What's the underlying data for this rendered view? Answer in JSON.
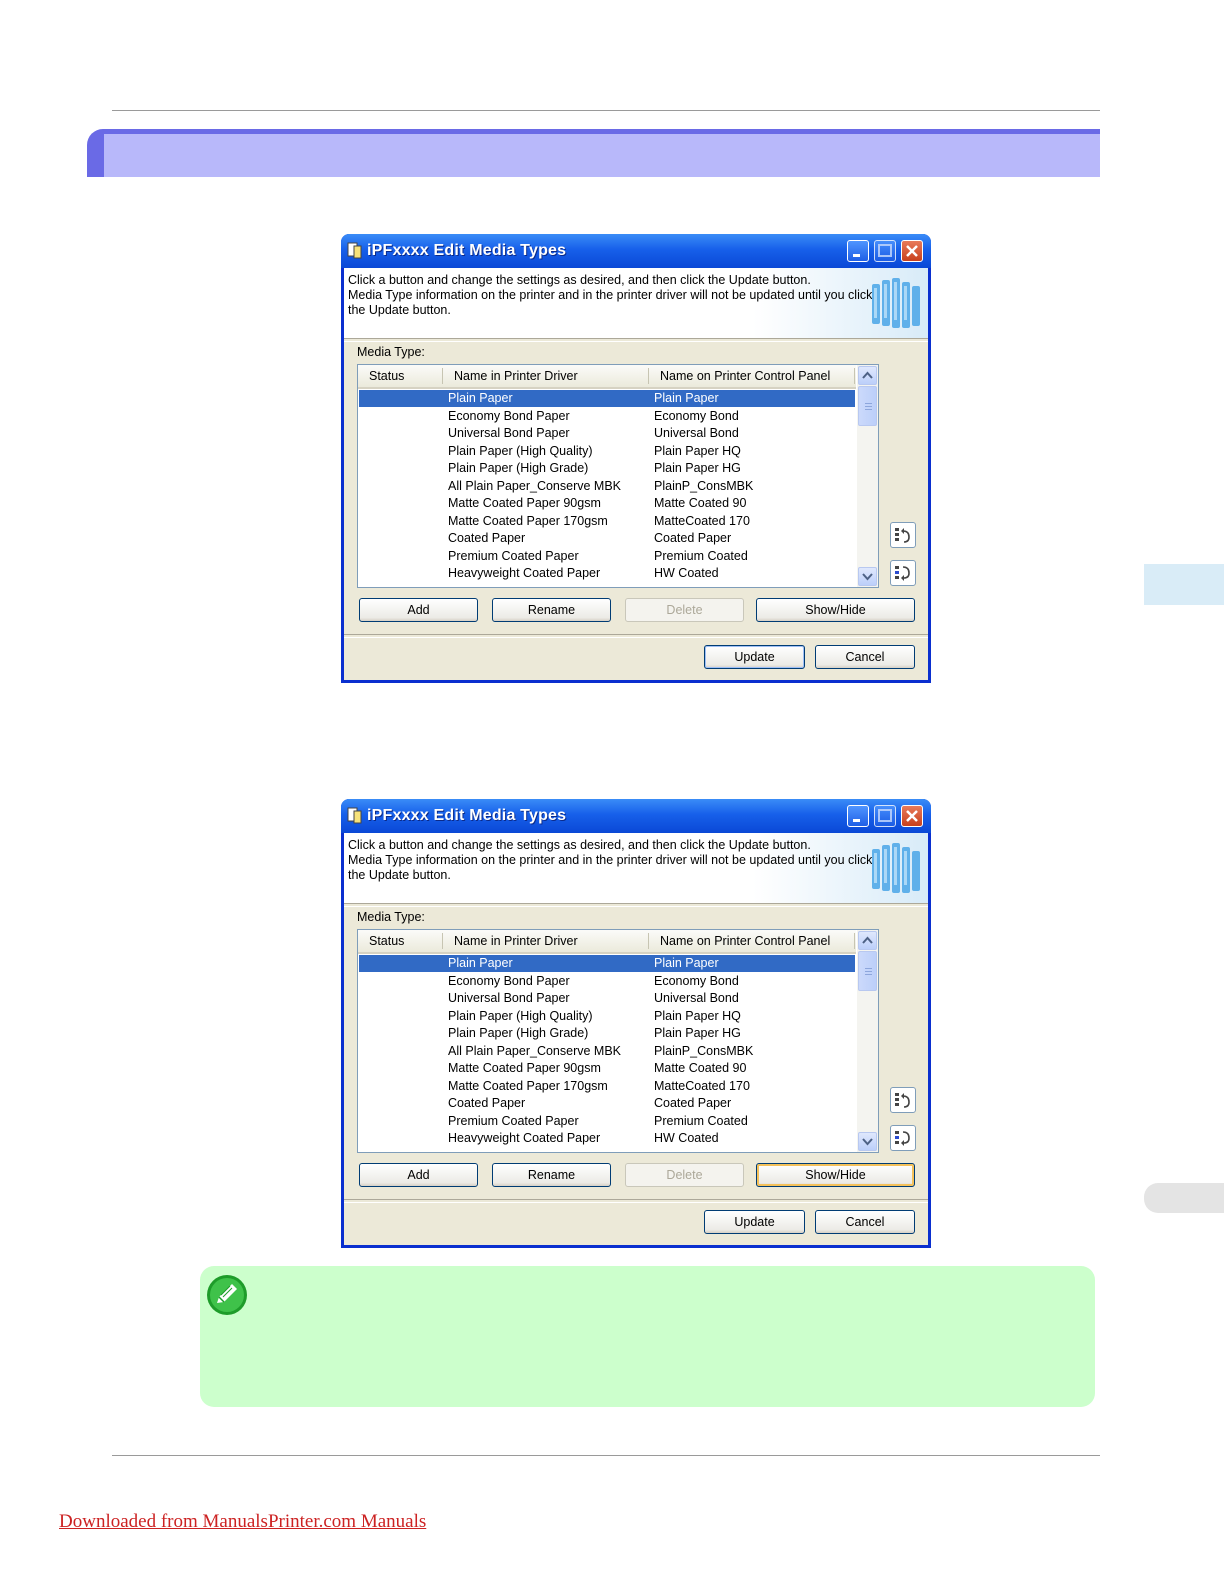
{
  "dialog_title": "iPFxxxx Edit Media Types",
  "instructions": [
    "Click a button and change the settings as desired, and then click the Update button.",
    "Media Type information on the printer and in the printer driver will not be updated until you click",
    "the Update button."
  ],
  "media_type_label": "Media Type:",
  "columns": [
    "Status",
    "Name in Printer Driver",
    "Name on Printer Control Panel"
  ],
  "rows": [
    {
      "driver": "Plain Paper",
      "panel": "Plain Paper",
      "selected": true
    },
    {
      "driver": "Economy Bond Paper",
      "panel": "Economy Bond"
    },
    {
      "driver": "Universal Bond Paper",
      "panel": "Universal Bond"
    },
    {
      "driver": "Plain Paper (High Quality)",
      "panel": "Plain Paper HQ"
    },
    {
      "driver": "Plain Paper (High Grade)",
      "panel": "Plain Paper HG"
    },
    {
      "driver": "All Plain Paper_Conserve MBK",
      "panel": "PlainP_ConsMBK"
    },
    {
      "driver": "Matte Coated Paper 90gsm",
      "panel": "Matte Coated 90"
    },
    {
      "driver": "Matte Coated Paper 170gsm",
      "panel": "MatteCoated 170"
    },
    {
      "driver": "Coated Paper",
      "panel": "Coated Paper"
    },
    {
      "driver": "Premium Coated Paper",
      "panel": "Premium Coated"
    },
    {
      "driver": "Heavyweight Coated Paper",
      "panel": "HW Coated"
    }
  ],
  "buttons": {
    "add": "Add",
    "rename": "Rename",
    "delete": "Delete",
    "show_hide": "Show/Hide",
    "update": "Update",
    "cancel": "Cancel"
  },
  "icons": {
    "move_up": "move-up-icon",
    "move_down": "move-down-icon",
    "note": "pencil-note-icon"
  },
  "footer_link": "Downloaded from ManualsPrinter.com Manuals",
  "colors": {
    "section_bar": "#b8b8fa",
    "note_bg": "#ccffcc",
    "selection": "#316ac5",
    "title_bar": "#0a48d6"
  }
}
